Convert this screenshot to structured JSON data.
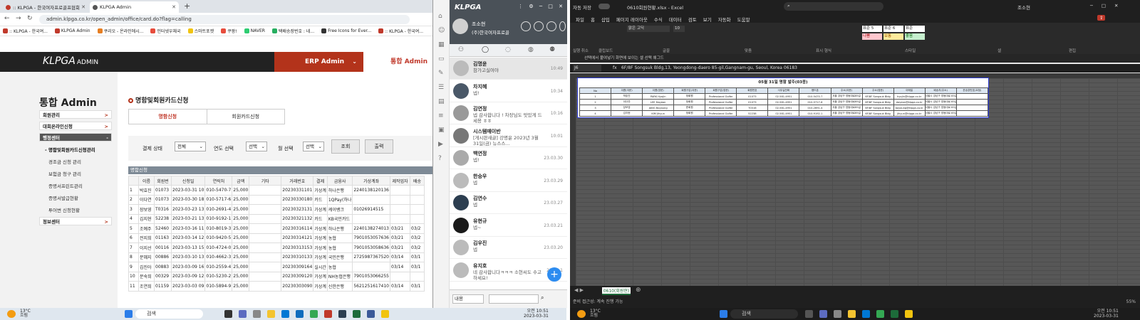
{
  "browser": {
    "tabs": [
      {
        "title": ":: KLPGA - 한국여자프로골프협회"
      },
      {
        "title": "KLPGA Admin"
      }
    ],
    "new_tab": "+",
    "url": "admin.klpga.co.kr/open_admin/office/card.do?flag=calling",
    "bookmarks": [
      ":: KLPGA - 한국여...",
      "KLPGA Admin",
      "쿠리오 - 온라인에시...",
      "인터넷우체국",
      "스마트포켓",
      "쿠팡!",
      "NAVER",
      "택배송장번호 : 네...",
      "Free Icons for Ever...",
      ":: KLPGA - 한국여..."
    ]
  },
  "site": {
    "logo": "KLPGA",
    "logo_sub": "ADMIN",
    "erp": "ERP Admin",
    "tong": "통합 Admin",
    "nav_title": "통합 Admin",
    "menu": [
      {
        "label": "회원관리",
        "arrow": ">"
      },
      {
        "label": "대회온라인신청",
        "arrow": ">"
      },
      {
        "label": "행정센터",
        "arrow": "-"
      }
    ],
    "submenu": [
      "명함및회원카드신청관리",
      "경조금 신청 관리",
      "보험금 청구 관리",
      "증명서프린트관리",
      "증명서발급현황",
      "투어변 신청현황"
    ],
    "menu_last": {
      "label": "정보센터",
      "arrow": ">"
    }
  },
  "page": {
    "title": "명함및회원카드신청",
    "tabs": [
      "명함신청",
      "회원카드신청"
    ],
    "filter": {
      "status_label": "결제 상태",
      "status_value": "전체",
      "year_label": "연도 선택",
      "year_value": "선택",
      "month_label": "월 선택",
      "month_value": "선택",
      "search_btn": "조회",
      "print_btn": "출력"
    },
    "grid_title": "명함신청",
    "columns": [
      "",
      "이름",
      "회원번",
      "신청일",
      "연락처",
      "금액",
      "기타",
      "거래번호",
      "결제",
      "금융사",
      "가상계좌",
      "제작업자",
      "배송"
    ],
    "rows": [
      [
        "1",
        "박효진",
        "01073",
        "2023-03-31 10",
        "010-5470-7",
        "25,000",
        "",
        "20230331101",
        "가상계",
        "하나은행",
        "2240138120136",
        "",
        ""
      ],
      [
        "2",
        "이다연",
        "01073",
        "2023-03-30 18",
        "010-5717-6",
        "25,000",
        "",
        "20230330180",
        "카드",
        "1QPay(하나",
        "",
        "",
        ""
      ],
      [
        "3",
        "장보영",
        "T0316",
        "2023-03-23 13",
        "010-2691-4",
        "25,000",
        "",
        "20230323131",
        "가상계",
        "케이뱅크",
        "01026914515",
        "",
        ""
      ],
      [
        "4",
        "김지현",
        "52238",
        "2023-03-21 13",
        "010-9192-1",
        "25,000",
        "",
        "20230321132",
        "카드",
        "KB국민카드",
        "",
        "",
        ""
      ],
      [
        "5",
        "조예주",
        "52460",
        "2023-03-16 11",
        "010-8019-3",
        "25,000",
        "",
        "20230316114",
        "가상계",
        "하나은행",
        "2240138274013",
        "03/21",
        "03/2"
      ],
      [
        "6",
        "전지희",
        "01163",
        "2023-03-14 12",
        "010-9420-5",
        "25,000",
        "",
        "20230314121",
        "가상계",
        "농협",
        "7901053057636",
        "03/21",
        "03/2"
      ],
      [
        "7",
        "이지선",
        "00116",
        "2023-03-13 15",
        "010-4724-0",
        "25,000",
        "",
        "20230313153",
        "가상계",
        "농협",
        "7901053058636",
        "03/21",
        "03/2"
      ],
      [
        "8",
        "문혜지",
        "00886",
        "2023-03-10 13",
        "010-4662-3",
        "25,000",
        "",
        "20230310133",
        "가상계",
        "국민은행",
        "2725987367520",
        "03/14",
        "03/1"
      ],
      [
        "9",
        "김진아",
        "00883",
        "2023-03-09 16",
        "010-2559-4",
        "25,000",
        "",
        "20230309164",
        "실시간",
        "농협",
        "",
        "03/14",
        "03/1"
      ],
      [
        "10",
        "문숙희",
        "00329",
        "2023-03-09 12",
        "010-5230-2",
        "25,000",
        "",
        "20230309120",
        "가상계",
        "NH농협은행",
        "7901053066255",
        "",
        ""
      ],
      [
        "11",
        "조연희",
        "01159",
        "2023-03-03 09",
        "010-5894-9",
        "25,000",
        "",
        "20230303090",
        "가상계",
        "신한은행",
        "5621251617410",
        "03/14",
        "03/1"
      ]
    ]
  },
  "messenger": {
    "logo": "KLPGA",
    "window_controls": "⋮ ⚙ ─ □ ✕",
    "user_name": "조소현",
    "user_org": "(주)한국여자프로골",
    "chats": [
      {
        "name": "김명윤",
        "msg": "참가고실여야",
        "time": "10:49"
      },
      {
        "name": "차지혜",
        "msg": "넵!",
        "time": "10:34"
      },
      {
        "name": "김연정",
        "msg": "넵 감사합니다 ! 차장님도 맛있게 드세용 ㅎㅎ",
        "time": "10:16"
      },
      {
        "name": "시스템매이반",
        "msg": "[게시판새글] 강명윤 2023년 3월 31일(금) 뉴스스...",
        "time": "10:01"
      },
      {
        "name": "백연정",
        "msg": "넵!",
        "time": "23.03.30"
      },
      {
        "name": "한승우",
        "msg": "넵",
        "time": "23.03.29"
      },
      {
        "name": "김연수",
        "msg": "넵",
        "time": "23.03.27"
      },
      {
        "name": "유현규",
        "msg": "넵~",
        "time": "23.03.21"
      },
      {
        "name": "김우진",
        "msg": "넵",
        "time": "23.03.20"
      },
      {
        "name": "유지호",
        "msg": "네 감사합니다ㅋㅋㅋ 소현씨도 수고하세요!",
        "time": "23.03.1"
      }
    ],
    "footer_select": "내용",
    "fab": "+"
  },
  "excel": {
    "title": "0610회원현황.xlsx  -  Excel",
    "autosave": "자동 저장",
    "user": "조소현",
    "menu": [
      "파일",
      "홈",
      "삽입",
      "페이지 레이아웃",
      "수식",
      "데이터",
      "검토",
      "보기",
      "자동화",
      "도움말"
    ],
    "groups": [
      "실행 취소",
      "클립보드",
      "글꼴",
      "맞춤",
      "표시 형식",
      "스타일",
      "셀",
      "편집"
    ],
    "font_name": "맑은 고딕",
    "font_size": "10",
    "styles": [
      "표준 5",
      "표준 6",
      "표준",
      "나쁨",
      "보통",
      "좋음"
    ],
    "notice": "선택에서 붙여넣기   화면에 보이는 셀 선택   왜그드",
    "name_box": "J6",
    "formula": "6F/8F Songsuk Bldg,13, Yeongdong-daero 85-gil,Gangnam-gu, Seoul, Korea 06183",
    "sheet_title": "05월 31일 명함 발주(03종)",
    "sheet_headers": [
      "No",
      "이름(국문)",
      "이름(영문)",
      "회원구분(국문)",
      "회원구분(영문)",
      "회원번호",
      "사무실전화",
      "핸드폰",
      "주소(국문)",
      "주소(영문)",
      "이메일",
      "배송지(주소)",
      "운송장번호(요청)"
    ],
    "sheet_rows": [
      [
        "1",
        "박효진",
        "PARK Hyojin",
        "정회원",
        "Professional Golfer",
        "01073",
        "02-581-4951",
        "010-5470-7",
        "서울 강남구 영동대로85길",
        "6F/8F Songsuk Bldg",
        "hyojin@klpga.co.kr",
        "서울시 강남구 영동대로 85길",
        ""
      ],
      [
        "2",
        "이다연",
        "LEE Dayeon",
        "정회원",
        "Professional Golfer",
        "01073",
        "02-581-4951",
        "010-5717-6",
        "서울 강남구 영동대로85길",
        "6F/8F Songsuk Bldg",
        "dayeon@klpga.co.kr",
        "서울시 강남구 영동대로 85길",
        ""
      ],
      [
        "3",
        "장보영",
        "JANG Boyoung",
        "준회원",
        "Professional Golfer",
        "T0316",
        "02-581-4951",
        "010-2691-4",
        "서울 강남구 영동대로85길",
        "6F/8F Songsuk Bldg",
        "boyoung@klpga.co.kr",
        "서울시 강남구 영동대로 85길",
        ""
      ],
      [
        "4",
        "김지현",
        "KIM Jihyun",
        "정회원",
        "Professional Golfer",
        "52238",
        "02-581-4951",
        "010-9192-1",
        "서울 강남구 영동대로85길",
        "6F/8F Songsuk Bldg",
        "jihyun@klpga.co.kr",
        "서울시 강남구 영동대로 85길",
        ""
      ]
    ],
    "sheet_tab": "0610(회원현)",
    "status": "준비   접근성: 계속 진행 가능",
    "zoom": "55%"
  },
  "taskbar_left": {
    "temp": "13°C",
    "weather": "흐림",
    "search": "검색",
    "time": "오전 10:51",
    "date": "2023-03-31"
  },
  "taskbar_right": {
    "temp": "13°C",
    "weather": "흐림",
    "search": "검색",
    "time": "오전 10:51",
    "date": "2023-03-31"
  },
  "colors": {
    "accent": "#b3331b",
    "excel_green": "#1d6b3a",
    "messenger_head": "#4a5158",
    "fab": "#2d8cf0"
  }
}
